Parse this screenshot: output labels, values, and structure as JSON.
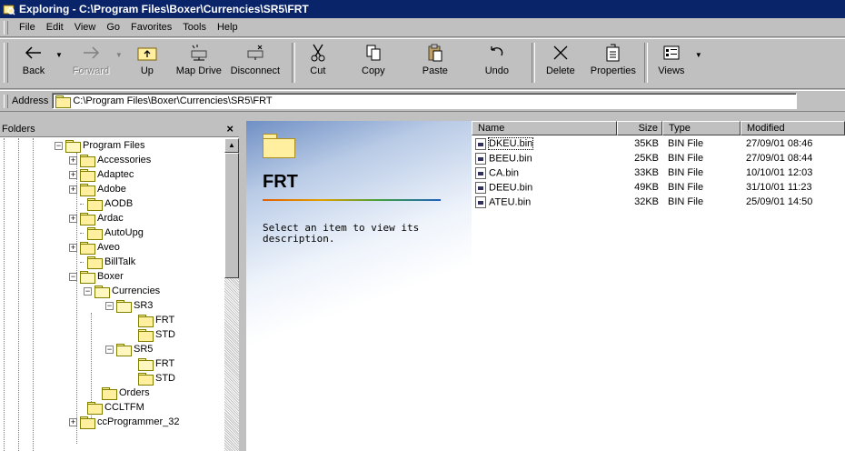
{
  "window": {
    "title": "Exploring - C:\\Program Files\\Boxer\\Currencies\\SR5\\FRT"
  },
  "menu": [
    {
      "label": "File",
      "key": "F"
    },
    {
      "label": "Edit",
      "key": "E"
    },
    {
      "label": "View",
      "key": "V"
    },
    {
      "label": "Go",
      "key": "G"
    },
    {
      "label": "Favorites",
      "key": "a"
    },
    {
      "label": "Tools",
      "key": "T"
    },
    {
      "label": "Help",
      "key": "H"
    }
  ],
  "toolbar": {
    "back": "Back",
    "forward": "Forward",
    "up": "Up",
    "map_drive": "Map Drive",
    "disconnect": "Disconnect",
    "cut": "Cut",
    "copy": "Copy",
    "paste": "Paste",
    "undo": "Undo",
    "delete": "Delete",
    "properties": "Properties",
    "views": "Views"
  },
  "address": {
    "label": "Address",
    "value": "C:\\Program Files\\Boxer\\Currencies\\SR5\\FRT"
  },
  "folders_pane": {
    "title": "Folders",
    "close_glyph": "×",
    "tree": [
      {
        "label": "Program Files",
        "expander": "−"
      },
      {
        "label": "Accessories",
        "expander": "+"
      },
      {
        "label": "Adaptec",
        "expander": "+"
      },
      {
        "label": "Adobe",
        "expander": "+"
      },
      {
        "label": "AODB",
        "expander": ""
      },
      {
        "label": "Ardac",
        "expander": "+"
      },
      {
        "label": "AutoUpg",
        "expander": ""
      },
      {
        "label": "Aveo",
        "expander": "+"
      },
      {
        "label": "BillTalk",
        "expander": ""
      },
      {
        "label": "Boxer",
        "expander": "−"
      },
      {
        "label": "Currencies",
        "expander": "−"
      },
      {
        "label": "SR3",
        "expander": "−"
      },
      {
        "label": "FRT",
        "expander": ""
      },
      {
        "label": "STD",
        "expander": ""
      },
      {
        "label": "SR5",
        "expander": "−"
      },
      {
        "label": "FRT",
        "expander": "",
        "open": true
      },
      {
        "label": "STD",
        "expander": ""
      },
      {
        "label": "Orders",
        "expander": ""
      },
      {
        "label": "CCLTFM",
        "expander": ""
      },
      {
        "label": "ccProgrammer_32",
        "expander": "+"
      }
    ]
  },
  "webview": {
    "title": "FRT",
    "description": "Select an item to view its description."
  },
  "file_list": {
    "columns": {
      "name": "Name",
      "size": "Size",
      "type": "Type",
      "modified": "Modified"
    },
    "rows": [
      {
        "name": "DKEU.bin",
        "size": "35KB",
        "type": "BIN File",
        "modified": "27/09/01 08:46"
      },
      {
        "name": "BEEU.bin",
        "size": "25KB",
        "type": "BIN File",
        "modified": "27/09/01 08:44"
      },
      {
        "name": "CA.bin",
        "size": "33KB",
        "type": "BIN File",
        "modified": "10/10/01 12:03"
      },
      {
        "name": "DEEU.bin",
        "size": "49KB",
        "type": "BIN File",
        "modified": "31/10/01 11:23"
      },
      {
        "name": "ATEU.bin",
        "size": "32KB",
        "type": "BIN File",
        "modified": "25/09/01 14:50"
      }
    ]
  }
}
